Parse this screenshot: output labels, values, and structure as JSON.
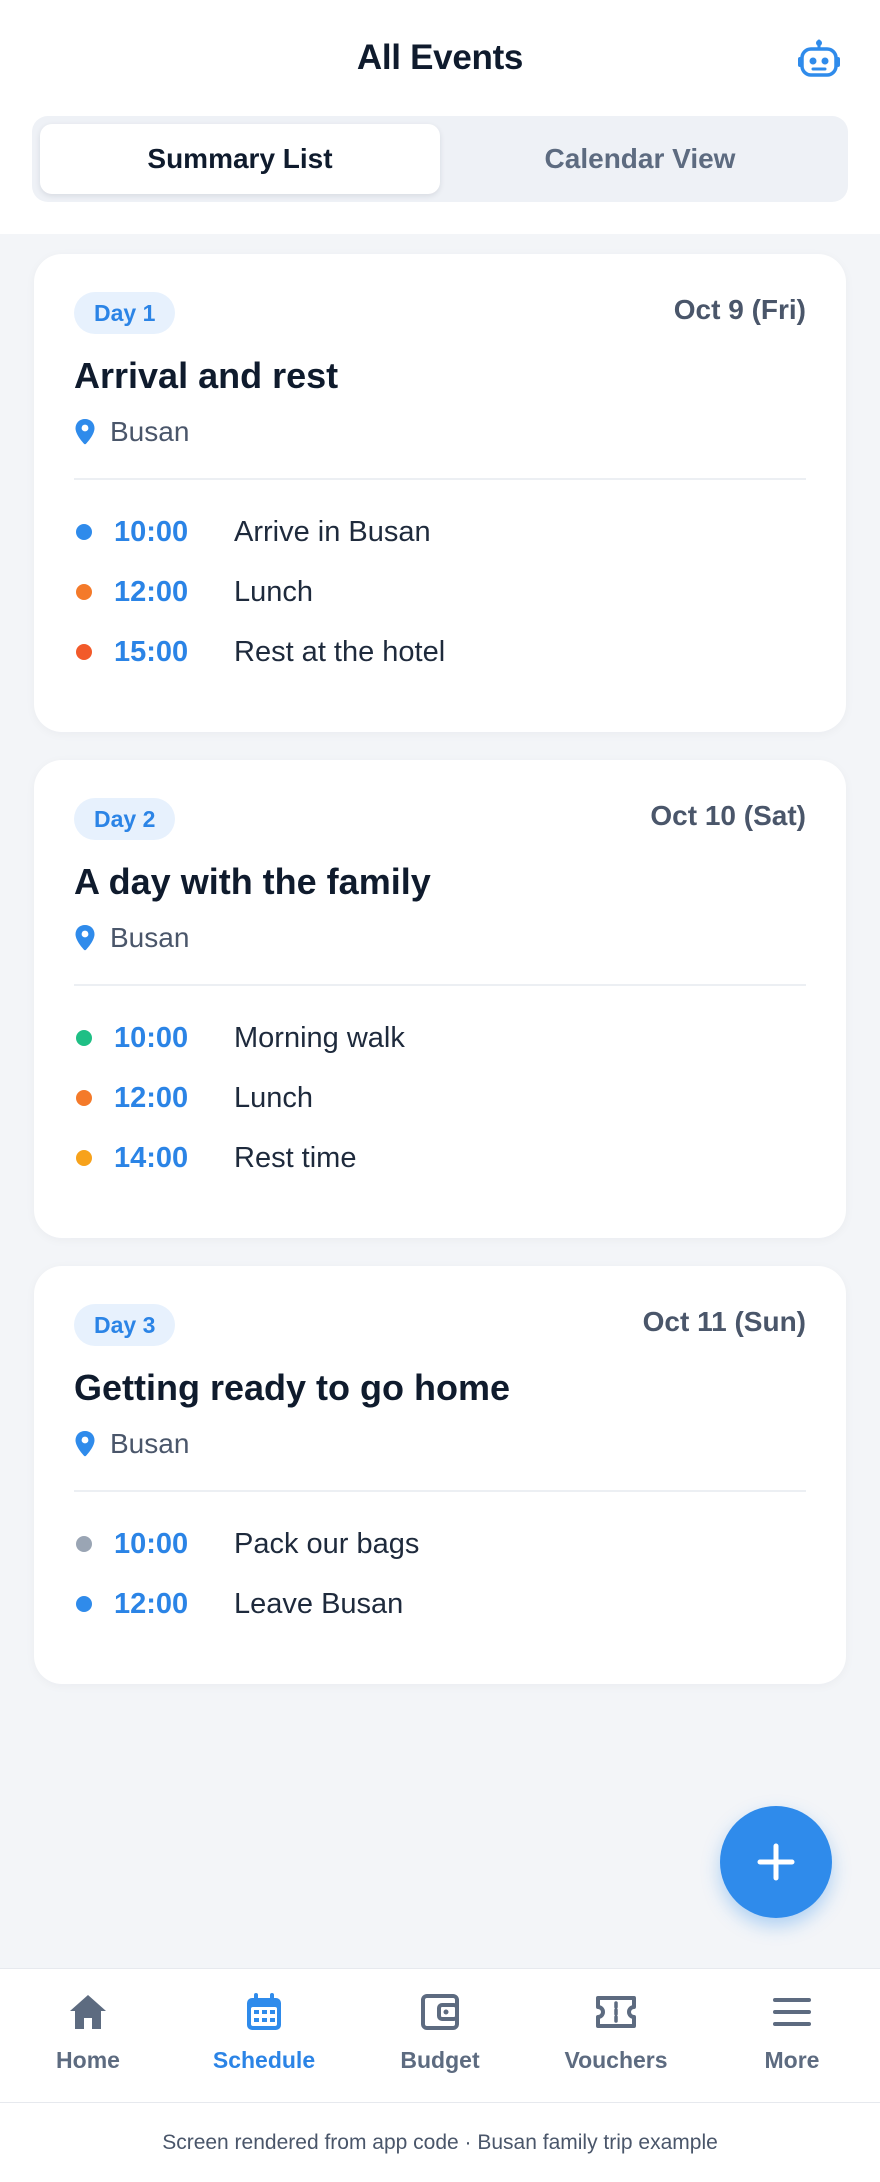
{
  "header": {
    "title": "All Events",
    "assistant_icon": "robot-icon"
  },
  "view_toggle": {
    "options": [
      "Summary List",
      "Calendar View"
    ],
    "selected": "Summary List"
  },
  "days": [
    {
      "badge": "Day 1",
      "date": "Oct 9 (Fri)",
      "title": "Arrival and rest",
      "location": "Busan",
      "events": [
        {
          "time": "10:00",
          "name": "Arrive in Busan",
          "color": "#2f8beb"
        },
        {
          "time": "12:00",
          "name": "Lunch",
          "color": "#f47a2a"
        },
        {
          "time": "15:00",
          "name": "Rest at the hotel",
          "color": "#f25a2a"
        }
      ]
    },
    {
      "badge": "Day 2",
      "date": "Oct 10 (Sat)",
      "title": "A day with the family",
      "location": "Busan",
      "events": [
        {
          "time": "10:00",
          "name": "Morning walk",
          "color": "#1fbf85"
        },
        {
          "time": "12:00",
          "name": "Lunch",
          "color": "#f47a2a"
        },
        {
          "time": "14:00",
          "name": "Rest time",
          "color": "#f7a21b"
        }
      ]
    },
    {
      "badge": "Day 3",
      "date": "Oct 11 (Sun)",
      "title": "Getting ready to go home",
      "location": "Busan",
      "events": [
        {
          "time": "10:00",
          "name": "Pack our bags",
          "color": "#9aa5b4"
        },
        {
          "time": "12:00",
          "name": "Leave Busan",
          "color": "#2f8beb"
        }
      ]
    }
  ],
  "fab": {
    "icon": "plus-icon"
  },
  "tabbar": {
    "items": [
      {
        "label": "Home",
        "icon": "home-icon"
      },
      {
        "label": "Schedule",
        "icon": "calendar-icon"
      },
      {
        "label": "Budget",
        "icon": "wallet-icon"
      },
      {
        "label": "Vouchers",
        "icon": "ticket-icon"
      },
      {
        "label": "More",
        "icon": "menu-icon"
      }
    ],
    "active": "Schedule"
  },
  "footer": {
    "caption": "Screen rendered from app code · Busan family trip example"
  },
  "colors": {
    "accent": "#2b84e6",
    "text": "#0f1b2d",
    "muted": "#5d6b80",
    "background": "#f3f5f8"
  }
}
